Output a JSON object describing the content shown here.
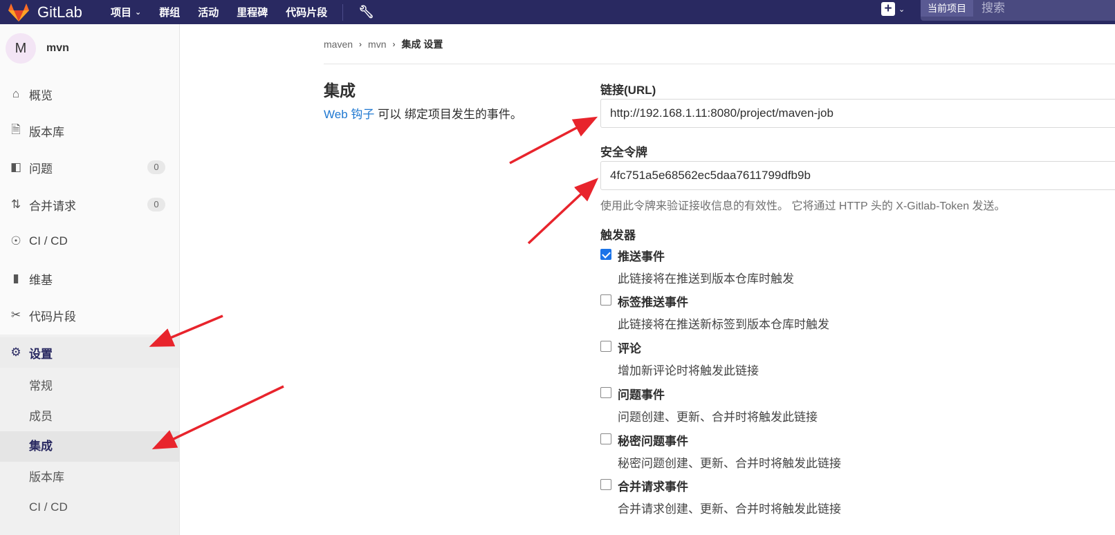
{
  "navbar": {
    "logo_text": "GitLab",
    "menu": [
      "项目",
      "群组",
      "活动",
      "里程碑",
      "代码片段"
    ],
    "scope_label": "当前项目",
    "search_placeholder": "搜索"
  },
  "project": {
    "avatar_letter": "M",
    "name": "mvn"
  },
  "sidebar": {
    "items": [
      {
        "label": "概览",
        "icon": "home-icon"
      },
      {
        "label": "版本库",
        "icon": "doc-icon"
      },
      {
        "label": "问题",
        "icon": "issues-icon",
        "count": "0"
      },
      {
        "label": "合并请求",
        "icon": "merge-request-icon",
        "count": "0"
      },
      {
        "label": "CI / CD",
        "icon": "rocket-icon"
      },
      {
        "label": "维基",
        "icon": "book-icon"
      },
      {
        "label": "代码片段",
        "icon": "scissors-icon"
      },
      {
        "label": "设置",
        "icon": "gear-icon"
      }
    ],
    "sub_items": [
      "常规",
      "成员",
      "集成",
      "版本库",
      "CI / CD"
    ]
  },
  "breadcrumb": [
    "maven",
    "mvn",
    "集成 设置"
  ],
  "section": {
    "title": "集成",
    "desc_link": "Web 钩子",
    "desc_rest": " 可以 绑定项目发生的事件。"
  },
  "form": {
    "url_label": "链接(URL)",
    "url_value": "http://192.168.1.11:8080/project/maven-job",
    "token_label": "安全令牌",
    "token_value": "4fc751a5e68562ec5daa7611799dfb9b",
    "token_help": "使用此令牌来验证接收信息的有效性。 它将通过 HTTP 头的 X-Gitlab-Token 发送。",
    "triggers_label": "触发器",
    "triggers": [
      {
        "title": "推送事件",
        "desc": "此链接将在推送到版本仓库时触发",
        "checked": true
      },
      {
        "title": "标签推送事件",
        "desc": "此链接将在推送新标签到版本仓库时触发",
        "checked": false
      },
      {
        "title": "评论",
        "desc": "增加新评论时将触发此链接",
        "checked": false
      },
      {
        "title": "问题事件",
        "desc": "问题创建、更新、合并时将触发此链接",
        "checked": false
      },
      {
        "title": "秘密问题事件",
        "desc": "秘密问题创建、更新、合并时将触发此链接",
        "checked": false
      },
      {
        "title": "合并请求事件",
        "desc": "合并请求创建、更新、合并时将触发此链接",
        "checked": false
      }
    ]
  },
  "colors": {
    "navbar": "#292961",
    "annotation_arrow": "#e8242c",
    "link": "#1f78d1"
  }
}
